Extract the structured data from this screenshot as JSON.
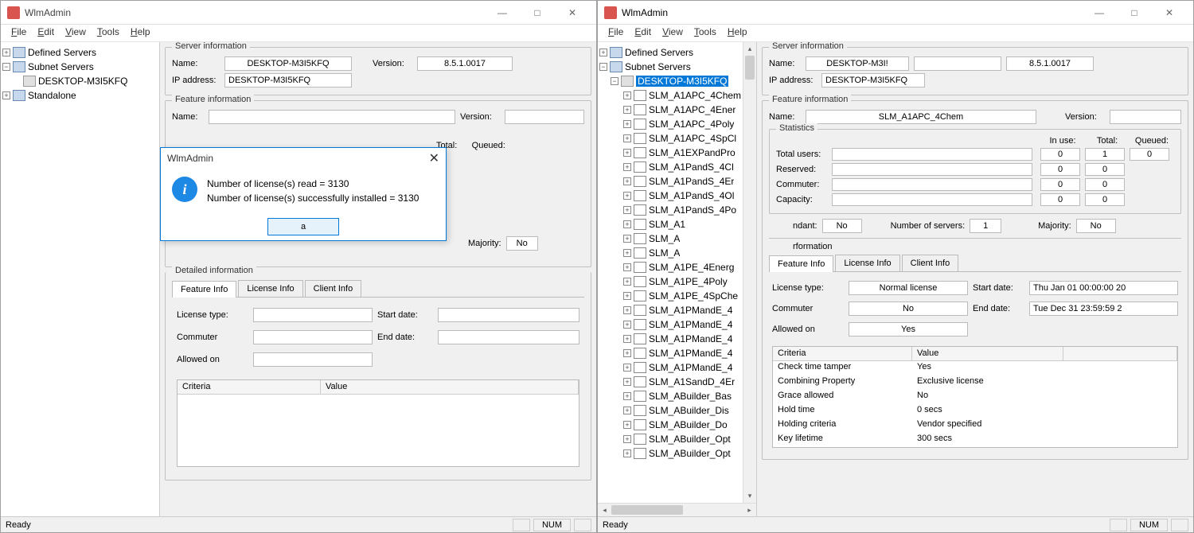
{
  "app_title": "WlmAdmin",
  "menu": {
    "file": "File",
    "edit": "Edit",
    "view": "View",
    "tools": "Tools",
    "help": "Help"
  },
  "tree": {
    "defined_servers": "Defined Servers",
    "subnet_servers": "Subnet Servers",
    "standalone": "Standalone",
    "computer": "DESKTOP-M3I5KFQ",
    "features": [
      "SLM_A1APC_4Chem",
      "SLM_A1APC_4Ener",
      "SLM_A1APC_4Poly",
      "SLM_A1APC_4SpCl",
      "SLM_A1EXPandPro",
      "SLM_A1PandS_4Cl",
      "SLM_A1PandS_4Er",
      "SLM_A1PandS_4Ol",
      "SLM_A1PandS_4Po",
      "SLM_A1",
      "SLM_A",
      "SLM_A",
      "SLM_A1PE_4Energ",
      "SLM_A1PE_4Poly",
      "SLM_A1PE_4SpChe",
      "SLM_A1PMandE_4",
      "SLM_A1PMandE_4",
      "SLM_A1PMandE_4",
      "SLM_A1PMandE_4",
      "SLM_A1PMandE_4",
      "SLM_A1SandD_4Er",
      "SLM_ABuilder_Bas",
      "SLM_ABuilder_Dis",
      "SLM_ABuilder_Do",
      "SLM_ABuilder_Opt",
      "SLM_ABuilder_Opt"
    ]
  },
  "server_info": {
    "title": "Server information",
    "name_label": "Name:",
    "name": "DESKTOP-M3I5KFQ",
    "name_clipped": "DESKTOP-M3I!",
    "version_label": "Version:",
    "version": "8.5.1.0017",
    "ip_label": "IP address:",
    "ip": "DESKTOP-M3I5KFQ"
  },
  "feature_info": {
    "title": "Feature information",
    "name_label": "Name:",
    "name_left": "",
    "name_right": "SLM_A1APC_4Chem",
    "version_label": "Version:",
    "version": ""
  },
  "statistics": {
    "title": "Statistics",
    "inuse_label": "In use:",
    "total_label": "Total:",
    "queued_label": "Queued:",
    "rows": [
      {
        "label": "Total users:",
        "inuse": "0",
        "total": "1",
        "queued": "0"
      },
      {
        "label": "Reserved:",
        "inuse": "0",
        "total": "0"
      },
      {
        "label": "Commuter:",
        "inuse": "0",
        "total": "0"
      },
      {
        "label": "Capacity:",
        "inuse": "0",
        "total": "0"
      }
    ],
    "redundant_label": "ndant:",
    "redundant": "No",
    "numservers_label": "Number of servers:",
    "numservers": "1",
    "majority_label": "Majority:",
    "majority": "No"
  },
  "detailed": {
    "title_left": "Detailed information",
    "title_right": "rformation",
    "tabs": {
      "feature": "Feature Info",
      "license": "License Info",
      "client": "Client Info"
    },
    "license_type_label": "License type:",
    "license_type": "Normal license",
    "start_label": "Start date:",
    "start": "Thu Jan 01 00:00:00 20",
    "commuter_label": "Commuter",
    "commuter": "No",
    "end_label": "End date:",
    "end": "Tue Dec 31 23:59:59 2",
    "allowed_label": "Allowed on",
    "allowed": "Yes",
    "criteria_label": "Criteria",
    "value_label": "Value",
    "rows": [
      {
        "c": "Check time tamper",
        "v": "Yes"
      },
      {
        "c": "Combining Property",
        "v": "Exclusive license"
      },
      {
        "c": "Grace allowed",
        "v": "No"
      },
      {
        "c": "Hold time",
        "v": "0 secs"
      },
      {
        "c": "Holding criteria",
        "v": "Vendor specified"
      },
      {
        "c": "Key lifetime",
        "v": "300 secs"
      }
    ]
  },
  "dialog": {
    "title": "WlmAdmin",
    "line1": "Number of license(s) read = 3130",
    "line2": "Number of license(s) successfully installed = 3130",
    "ok_partial": "a"
  },
  "status": {
    "ready": "Ready",
    "num": "NUM"
  }
}
